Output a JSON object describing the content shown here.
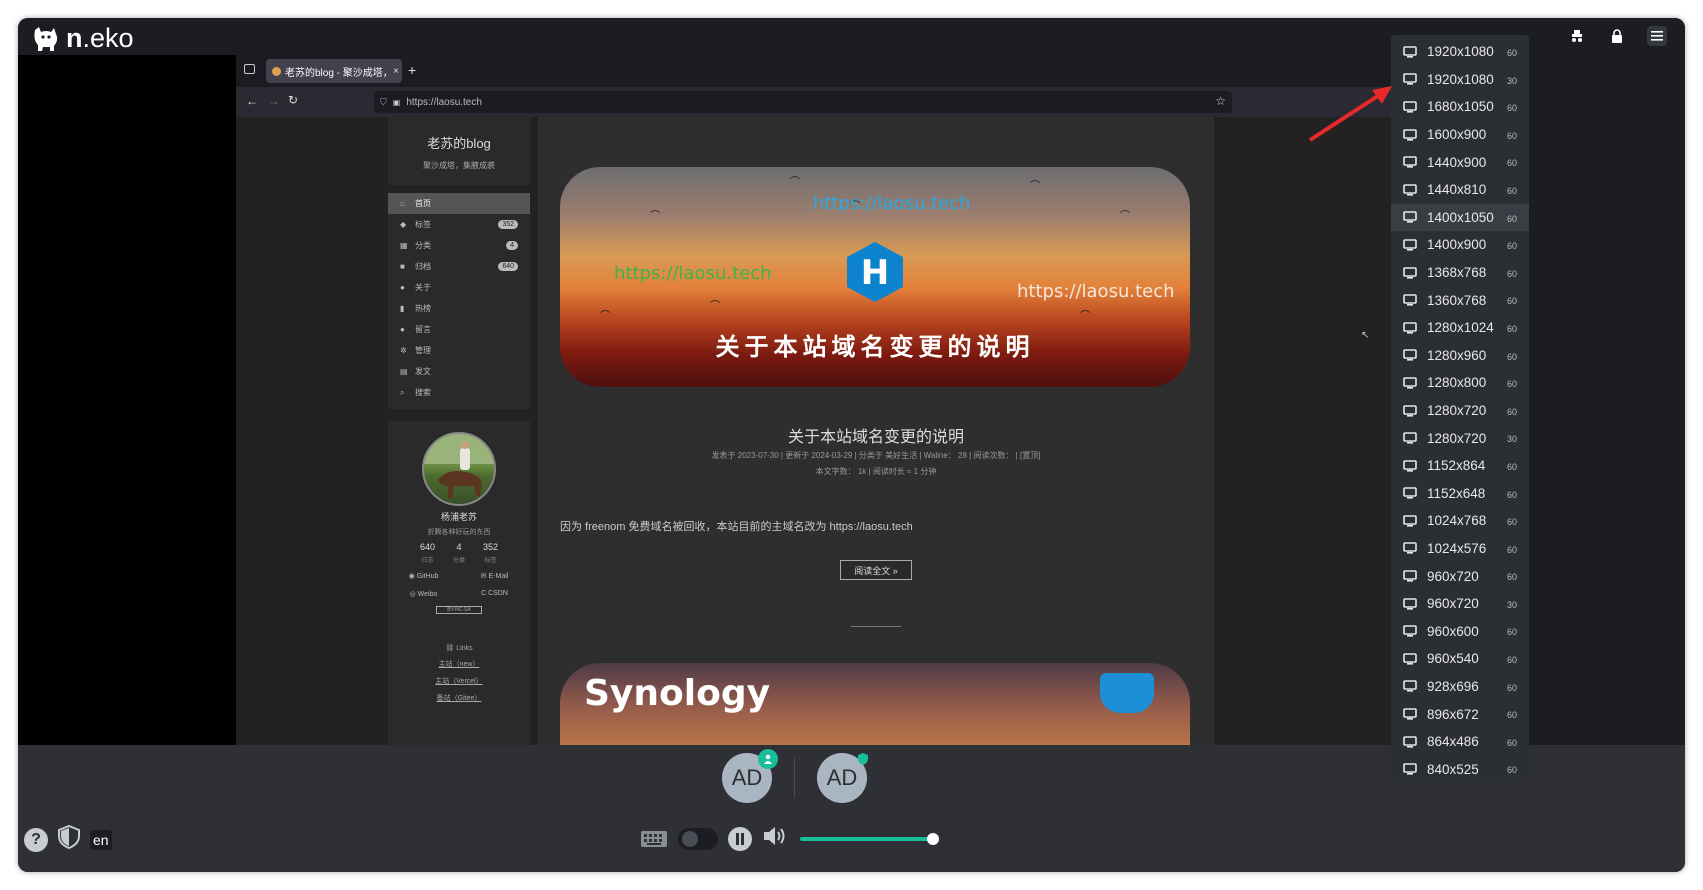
{
  "app": {
    "logo_prefix": "n",
    "logo_suffix": ".eko"
  },
  "browser": {
    "tab_title": "老苏的blog - 聚沙成塔，集",
    "url": "https://laosu.tech"
  },
  "blog": {
    "site_title": "老苏的blog",
    "site_subtitle": "聚沙成塔，集腋成裘",
    "menu": [
      {
        "icon": "home-icon",
        "glyph": "⌂",
        "label": "首页",
        "badge": ""
      },
      {
        "icon": "tag-icon",
        "glyph": "◆",
        "label": "标签",
        "badge": "352"
      },
      {
        "icon": "grid-icon",
        "glyph": "▦",
        "label": "分类",
        "badge": "4"
      },
      {
        "icon": "archive-icon",
        "glyph": "■",
        "label": "归档",
        "badge": "640"
      },
      {
        "icon": "user-icon",
        "glyph": "●",
        "label": "关于",
        "badge": ""
      },
      {
        "icon": "signal-icon",
        "glyph": "▮",
        "label": "热榜",
        "badge": ""
      },
      {
        "icon": "comment-icon",
        "glyph": "●",
        "label": "留言",
        "badge": ""
      },
      {
        "icon": "gear-icon",
        "glyph": "✲",
        "label": "管理",
        "badge": ""
      },
      {
        "icon": "book-icon",
        "glyph": "▤",
        "label": "发文",
        "badge": ""
      },
      {
        "icon": "search-icon",
        "glyph": "⌕",
        "label": "搜索",
        "badge": ""
      }
    ],
    "profile": {
      "name": "杨浦老苏",
      "desc": "折腾各种好玩的东西",
      "stats": [
        {
          "value": "640",
          "label": "日志"
        },
        {
          "value": "4",
          "label": "分类"
        },
        {
          "value": "352",
          "label": "标签"
        }
      ],
      "links": [
        "GitHub",
        "E-Mail",
        "Weibo",
        "CSDN"
      ],
      "license": "BY-NC-SA",
      "links_title": "Links",
      "link_items": [
        "主站（new）",
        "主站（Vercel）",
        "备站（Gitee）"
      ]
    },
    "post": {
      "banner_url_1": "https://laosu.tech",
      "banner_url_2": "https://laosu.tech",
      "banner_url_3": "https://laosu.tech",
      "banner_title": "关于本站域名变更的说明",
      "title": "关于本站域名变更的说明",
      "meta_line1": "发表于 2023-07-30 | 更新于 2024-03-29 | 分类于 美好生活 | Waline： 28 | 阅读次数： | [置顶]",
      "meta_line2": "本文字数： 1k | 阅读时长 ≈ 1 分钟",
      "excerpt": "因为 freenom 免费域名被回收，本站目前的主域名改为 https://laosu.tech",
      "read_more": "阅读全文 »",
      "next_banner_text": "Synology"
    }
  },
  "members": [
    {
      "initials": "AD",
      "status": "user-icon"
    },
    {
      "initials": "AD",
      "status": "shield-icon"
    }
  ],
  "bottom": {
    "lang": "en",
    "help": "?",
    "volume_fraction": 1.0
  },
  "resolutions": [
    {
      "label": "1920x1080",
      "rate": "60"
    },
    {
      "label": "1920x1080",
      "rate": "30"
    },
    {
      "label": "1680x1050",
      "rate": "60"
    },
    {
      "label": "1600x900",
      "rate": "60"
    },
    {
      "label": "1440x900",
      "rate": "60"
    },
    {
      "label": "1440x810",
      "rate": "60"
    },
    {
      "label": "1400x1050",
      "rate": "60"
    },
    {
      "label": "1400x900",
      "rate": "60"
    },
    {
      "label": "1368x768",
      "rate": "60"
    },
    {
      "label": "1360x768",
      "rate": "60"
    },
    {
      "label": "1280x1024",
      "rate": "60"
    },
    {
      "label": "1280x960",
      "rate": "60"
    },
    {
      "label": "1280x800",
      "rate": "60"
    },
    {
      "label": "1280x720",
      "rate": "60"
    },
    {
      "label": "1280x720",
      "rate": "30"
    },
    {
      "label": "1152x864",
      "rate": "60"
    },
    {
      "label": "1152x648",
      "rate": "60"
    },
    {
      "label": "1024x768",
      "rate": "60"
    },
    {
      "label": "1024x576",
      "rate": "60"
    },
    {
      "label": "960x720",
      "rate": "60"
    },
    {
      "label": "960x720",
      "rate": "30"
    },
    {
      "label": "960x600",
      "rate": "60"
    },
    {
      "label": "960x540",
      "rate": "60"
    },
    {
      "label": "928x696",
      "rate": "60"
    },
    {
      "label": "896x672",
      "rate": "60"
    },
    {
      "label": "864x486",
      "rate": "60"
    },
    {
      "label": "840x525",
      "rate": "60"
    }
  ],
  "resolution_active_index": 6,
  "colors": {
    "accent": "#19bd9c",
    "annotation_arrow": "#e8292b"
  }
}
